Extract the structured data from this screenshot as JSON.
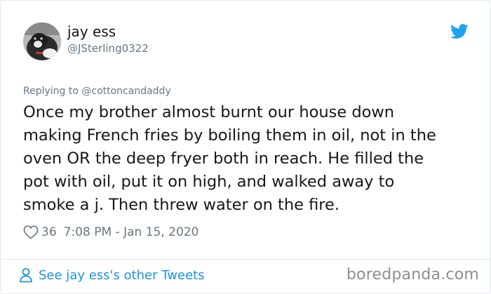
{
  "user": {
    "name": "jay ess",
    "handle": "@JSterling0322"
  },
  "reply": {
    "label": "Replying to @cottoncandaddy"
  },
  "tweet": {
    "lines": [
      "Once my brother almost burnt our house down",
      "making French fries by boiling them in oil, not in the",
      "oven OR the deep fryer both in reach.  He filled the",
      "pot with oil, put it on high, and walked away to",
      "smoke a j.  Then threw water on the fire."
    ]
  },
  "meta": {
    "likes": "36",
    "timestamp": "7:08 PM - Jan 15, 2020"
  },
  "footer": {
    "see_more": "See jay ess's other Tweets",
    "watermark": "boredpanda.com"
  },
  "colors": {
    "twitter_blue": "#1da1f2",
    "link_blue": "#1b95e0",
    "secondary_text": "#657786",
    "primary_text": "#14171a"
  },
  "icons": {
    "brand": "twitter-bird-icon",
    "like": "heart-outline-icon",
    "profile": "person-outline-icon"
  }
}
